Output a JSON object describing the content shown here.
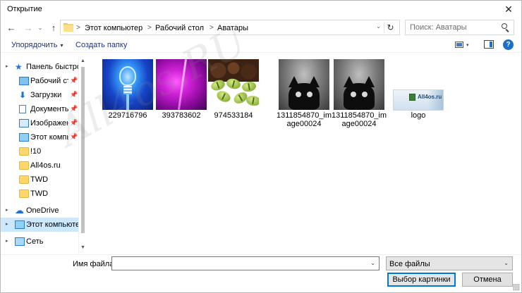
{
  "window": {
    "title": "Открытие",
    "close_glyph": "✕"
  },
  "nav": {
    "back": "←",
    "forward": "→",
    "recent": "⌄",
    "up": "↑"
  },
  "address": {
    "crumbs": [
      "Этот компьютер",
      "Рабочий стол",
      "Аватары"
    ],
    "separator": ">",
    "dropdown": "⌄",
    "refresh": "↻"
  },
  "search": {
    "placeholder": "Поиск: Аватары"
  },
  "toolbar": {
    "organize_label": "Упорядочить",
    "organize_caret": "▾",
    "new_folder_label": "Создать папку",
    "view_caret": "▾",
    "help_label": "?"
  },
  "sidebar": {
    "items": [
      {
        "label": "Панель быстрого доступа",
        "icon": "star-icon",
        "pinned": false,
        "expander": "▸"
      },
      {
        "label": "Рабочий стол",
        "icon": "desktop-icon",
        "pinned": true
      },
      {
        "label": "Загрузки",
        "icon": "download-icon",
        "pinned": true
      },
      {
        "label": "Документы",
        "icon": "document-icon",
        "pinned": true
      },
      {
        "label": "Изображения",
        "icon": "pictures-icon",
        "pinned": true
      },
      {
        "label": "Этот компьютер",
        "icon": "computer-icon",
        "pinned": true
      },
      {
        "label": "!10",
        "icon": "folder-icon",
        "pinned": false
      },
      {
        "label": "All4os.ru",
        "icon": "folder-icon",
        "pinned": false
      },
      {
        "label": "TWD",
        "icon": "folder-icon",
        "pinned": false
      },
      {
        "label": "TWD",
        "icon": "folder-icon",
        "pinned": false
      },
      {
        "label": "OneDrive",
        "icon": "cloud-icon",
        "pinned": false,
        "expander": "▸"
      },
      {
        "label": "Этот компьютер",
        "icon": "computer-icon",
        "pinned": false,
        "expander": "▸",
        "selected": true
      },
      {
        "label": "Сеть",
        "icon": "network-icon",
        "pinned": false,
        "expander": "▸"
      }
    ],
    "pin_glyph": "📌",
    "scroll_up": "▲",
    "scroll_down": "▼"
  },
  "files": [
    {
      "name": "229716796",
      "thumb": "bulb"
    },
    {
      "name": "393783602",
      "thumb": "purple"
    },
    {
      "name": "974533184",
      "thumb": "beans"
    },
    {
      "name": "1311854870_image00024",
      "thumb": "cat"
    },
    {
      "name": "1311854870_image00024",
      "thumb": "cat"
    },
    {
      "name": "logo",
      "thumb": "logo"
    }
  ],
  "logo_text": "All4os.ru",
  "bottom": {
    "filename_label": "Имя файла:",
    "filename_value": "",
    "filename_caret": "⌄",
    "filter_value": "Все файлы",
    "filter_caret": "⌄",
    "open_button": "Выбор картинки",
    "cancel_button": "Отмена"
  },
  "watermark": "All4os.RU"
}
